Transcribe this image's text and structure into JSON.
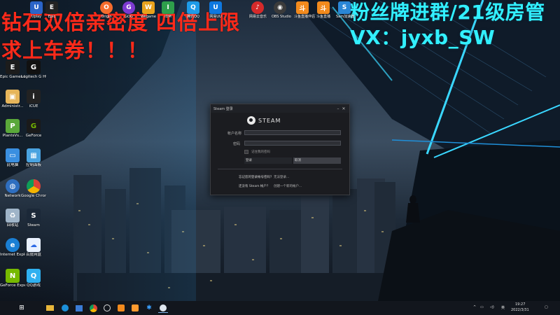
{
  "overlay": {
    "red_line1": "钻石双倍亲密度 四倍上限",
    "red_line2": "求上车券！！！",
    "cyan_line1": "粉丝牌进群/21级房管",
    "cyan_line2": "VX：jyxb_SW"
  },
  "top_icons": [
    {
      "label": "Uplay",
      "icon": "uplay-icon"
    },
    {
      "label": "Epic",
      "icon": "epic-icon"
    },
    {
      "label": "Origin",
      "icon": "origin-icon"
    },
    {
      "label": "GOG",
      "icon": "gog-icon"
    },
    {
      "label": "Wegame",
      "icon": "wegame-icon"
    },
    {
      "label": "IDM",
      "icon": "idm-icon"
    },
    {
      "label": "腾讯QQ",
      "icon": "qq-icon"
    },
    {
      "label": "网易UU",
      "icon": "uu-icon"
    },
    {
      "label": "网易云音乐",
      "icon": "netease-music-icon"
    },
    {
      "label": "OBS Studio",
      "icon": "obs-icon"
    },
    {
      "label": "斗鱼直播伴侣",
      "icon": "douyu-icon"
    },
    {
      "label": "斗鱼直播",
      "icon": "douyu-icon"
    },
    {
      "label": "Sam加速器",
      "icon": "sam-icon"
    }
  ],
  "left_icons": [
    {
      "label": "Epic Games Launcher",
      "icon": "epic-games-icon"
    },
    {
      "label": "Logitech G HUB",
      "icon": "logitech-icon"
    },
    {
      "label": "Administr...",
      "icon": "admin-icon"
    },
    {
      "label": "iCUE",
      "icon": "icue-icon"
    },
    {
      "label": "PlantsVs...",
      "icon": "plants-icon"
    },
    {
      "label": "GeForce",
      "icon": "geforce-icon"
    },
    {
      "label": "此电脑",
      "icon": "this-pc-icon"
    },
    {
      "label": "控制面板",
      "icon": "control-panel-icon"
    },
    {
      "label": "Network",
      "icon": "network-icon"
    },
    {
      "label": "Google Chrome",
      "icon": "chrome-icon"
    },
    {
      "label": "回收站",
      "icon": "recycle-bin-icon"
    },
    {
      "label": "Steam",
      "icon": "steam-icon"
    },
    {
      "label": "Internet Explorer",
      "icon": "ie-icon"
    },
    {
      "label": "百度网盘",
      "icon": "baidu-icon"
    },
    {
      "label": "GeForce Experience",
      "icon": "nvidia-icon"
    },
    {
      "label": "QQ游戏",
      "icon": "qq-game-icon"
    }
  ],
  "steam_dialog": {
    "title": "Steam 登录",
    "logo_text": "STEAM",
    "account_label": "帐户名称",
    "account_value": "",
    "password_label": "密码",
    "password_value": "",
    "remember_label": "记住我的密码",
    "login_button": "登录",
    "cancel_button": "取消",
    "help_question": "忘记您的登录帐号密码？",
    "help_link": "无法登录...",
    "new_question": "还没有 Steam 帐户？",
    "new_link": "创建一个新的帐户..."
  },
  "taskbar": {
    "lang": "英",
    "time": "19:27",
    "date": "2022/3/31"
  },
  "colors": {
    "overlay_red": "#ff2a1a",
    "overlay_cyan": "#32f0ff",
    "taskbar": "#12161d",
    "dialog_bg": "#1b1c20"
  }
}
